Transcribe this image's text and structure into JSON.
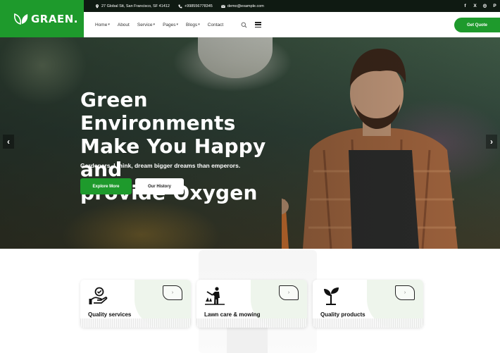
{
  "brand": {
    "name": "GRAEN.",
    "logo_icon": "leaf-icon",
    "color": "#1e9a2c"
  },
  "topbar": {
    "address": "27 Global Stt, San Francisco, SF 41412",
    "phone": "+998556778345",
    "email": "demo@example.com",
    "social": [
      "f",
      "X",
      "◎",
      "P"
    ]
  },
  "nav": {
    "items": [
      {
        "label": "Home",
        "dropdown": true
      },
      {
        "label": "About",
        "dropdown": false
      },
      {
        "label": "Service",
        "dropdown": true
      },
      {
        "label": "Pages",
        "dropdown": true
      },
      {
        "label": "Blogs",
        "dropdown": true
      },
      {
        "label": "Contact",
        "dropdown": false
      }
    ],
    "cta_label": "Get Quote"
  },
  "hero": {
    "title_lines": [
      "Green Environments",
      "Make You Happy and",
      "provide Oxygen"
    ],
    "subtitle": "Gardeners, I think, dream bigger dreams than emperors.",
    "primary_button": "Explore More",
    "secondary_button": "Our History",
    "prev_arrow": "‹",
    "next_arrow": "›"
  },
  "services": [
    {
      "title": "Quality services",
      "icon": "hand-award-icon"
    },
    {
      "title": "Lawn care & mowing",
      "icon": "gardener-icon"
    },
    {
      "title": "Quality products",
      "icon": "sprout-icon"
    }
  ],
  "card_arrow": "›"
}
